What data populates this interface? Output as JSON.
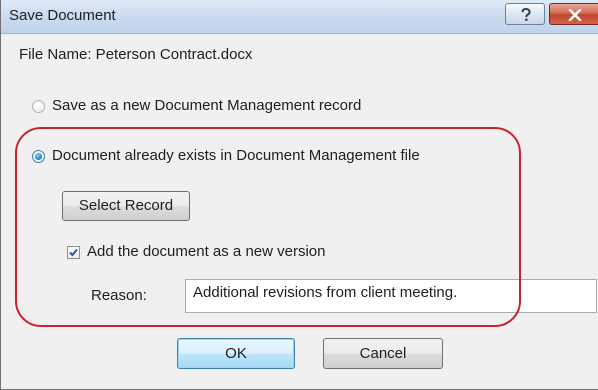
{
  "window": {
    "title": "Save Document",
    "help_label": "?"
  },
  "file": {
    "label": "File Name: Peterson Contract.docx"
  },
  "options": {
    "new_record_label": "Save as a new Document Management record",
    "new_record_checked": false,
    "existing_label": "Document already exists in Document Management file",
    "existing_checked": true
  },
  "select_record": {
    "label": "Select Record"
  },
  "new_version": {
    "label": "Add the document as a new version",
    "checked": true
  },
  "reason": {
    "label": "Reason:",
    "value": "Additional revisions from client meeting."
  },
  "buttons": {
    "ok_label": "OK",
    "cancel_label": "Cancel"
  },
  "colors": {
    "annotation": "#c8232c",
    "accent": "#2a8ad4"
  }
}
